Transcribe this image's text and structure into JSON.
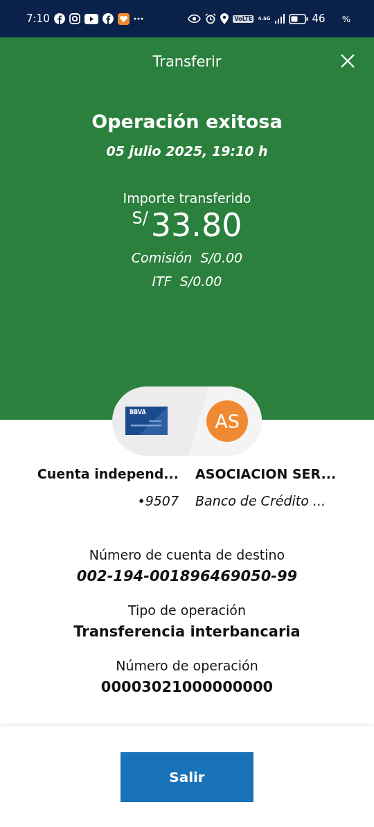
{
  "status_bar": {
    "time": "7:10",
    "network_badge": "VoLTE",
    "network_type": "4.5G",
    "battery": "46",
    "battery_unit": "%"
  },
  "header": {
    "title": "Transferir"
  },
  "result": {
    "title": "Operación exitosa",
    "datetime": "05 julio 2025, 19:10 h",
    "amount_label": "Importe transferido",
    "currency": "S/",
    "amount": "33.80",
    "fees": [
      {
        "label": "Comisión",
        "value": "S/0.00"
      },
      {
        "label": "ITF",
        "value": "S/0.00"
      }
    ]
  },
  "transfer": {
    "origin_card": "BBVA",
    "destination_initials": "AS",
    "origin_name": "Cuenta independ...",
    "origin_number": "•9507",
    "destination_name": "ASOCIACION SER...",
    "destination_bank": "Banco de Crédito ..."
  },
  "details": [
    {
      "label": "Número de cuenta de destino",
      "value": "002-194-001896469050-99",
      "italic": true
    },
    {
      "label": "Tipo de operación",
      "value": "Transferencia interbancaria",
      "italic": false
    },
    {
      "label": "Número de operación",
      "value": "00003021000000000",
      "italic": false
    }
  ],
  "exit_button": "Salir"
}
